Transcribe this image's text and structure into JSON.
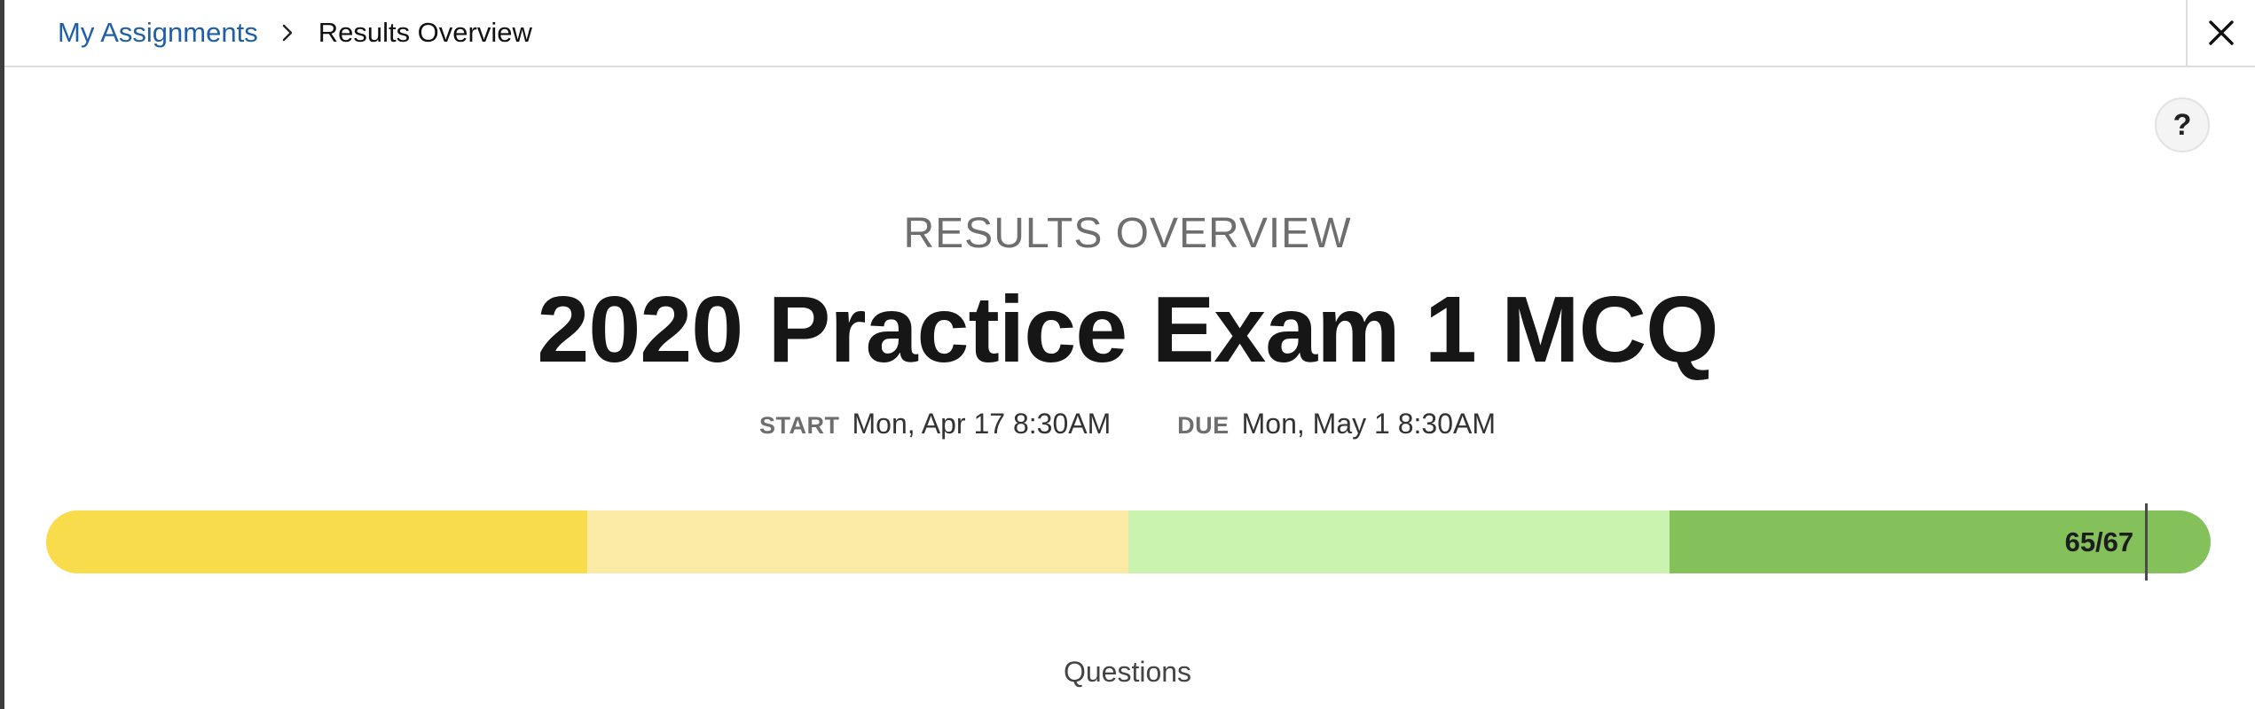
{
  "breadcrumb": {
    "parent": "My Assignments",
    "current": "Results Overview"
  },
  "icons": {
    "chevron": "chevron-right-icon",
    "close": "close-icon",
    "help": "help-icon"
  },
  "help_label": "?",
  "page": {
    "eyebrow": "RESULTS OVERVIEW",
    "title": "2020 Practice Exam 1 MCQ",
    "start_label": "START",
    "start_value": "Mon, Apr 17 8:30AM",
    "due_label": "DUE",
    "due_value": "Mon, May 1 8:30AM"
  },
  "score": {
    "text": "65/67",
    "earned": 65,
    "total": 67
  },
  "progress_bands": [
    {
      "color": "#f8dc4b"
    },
    {
      "color": "#faeaa5"
    },
    {
      "color": "#caf3b0"
    },
    {
      "color": "#84c15b"
    }
  ],
  "questions_label": "Questions"
}
